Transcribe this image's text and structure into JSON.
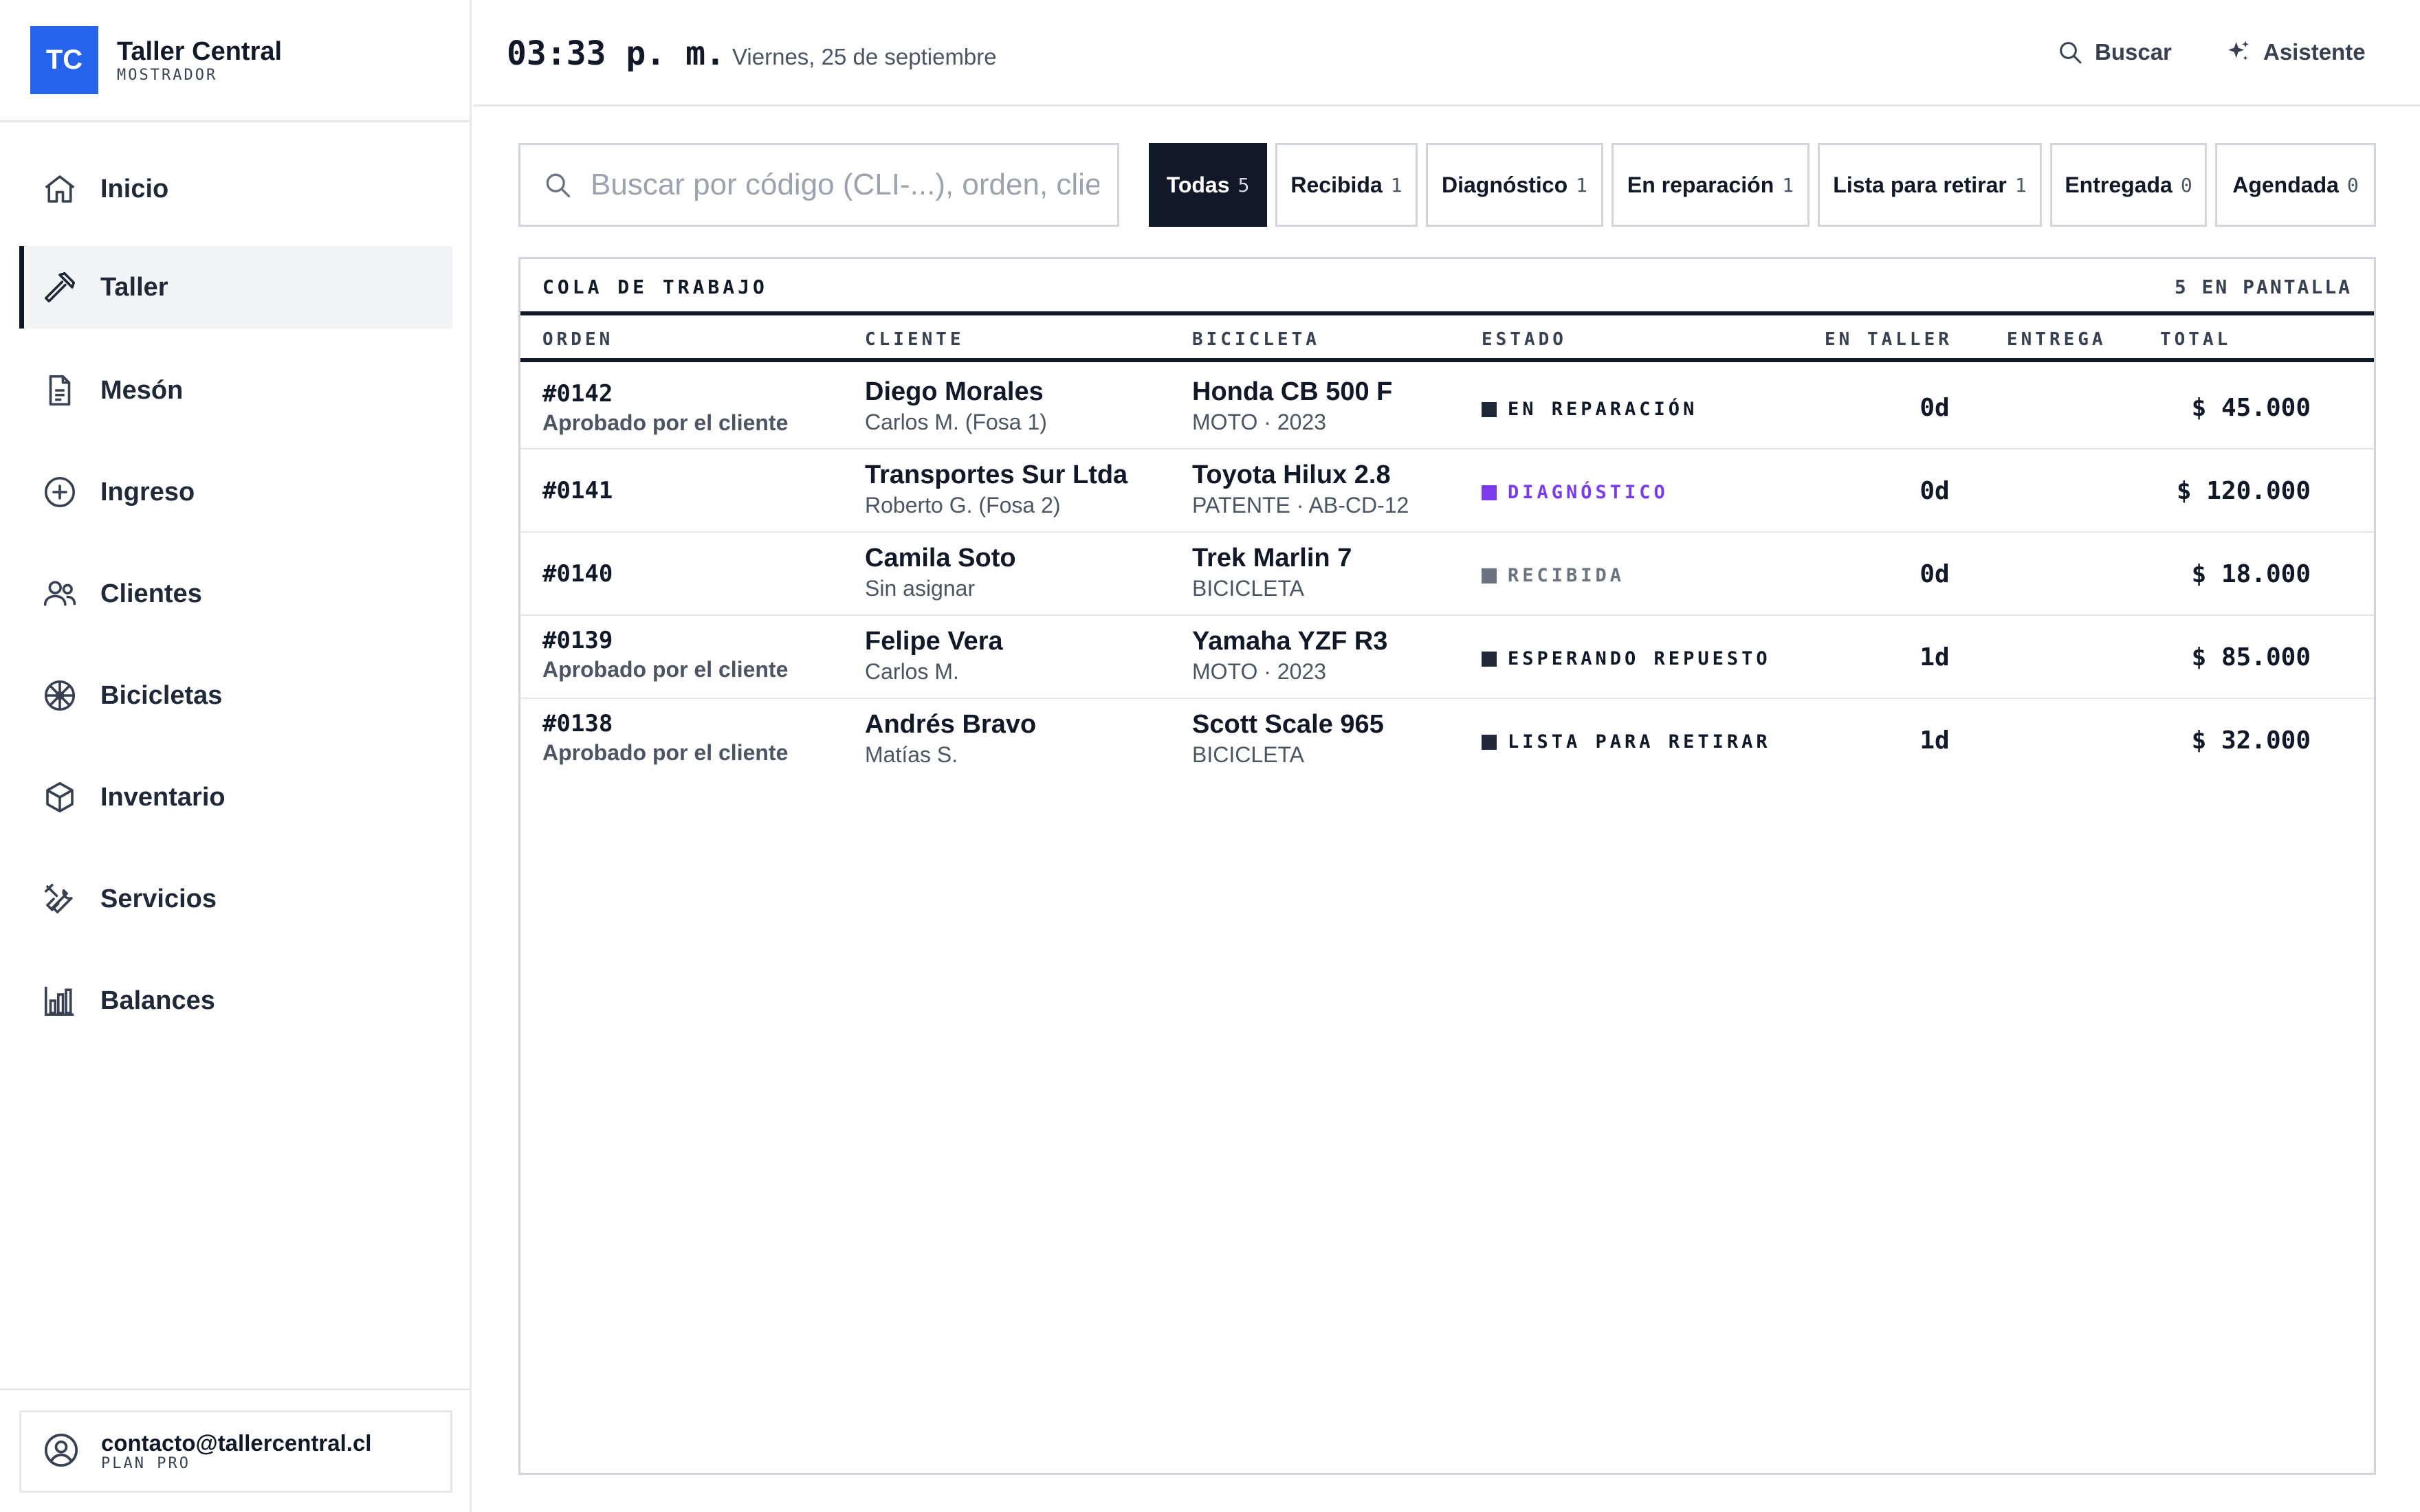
{
  "brand": {
    "logo": "TC",
    "name": "Taller Central",
    "role": "MOSTRADOR"
  },
  "nav": [
    {
      "label": "Inicio",
      "icon": "home-icon"
    },
    {
      "label": "Taller",
      "icon": "hammer-icon",
      "active": true
    },
    {
      "label": "Mesón",
      "icon": "document-icon"
    },
    {
      "label": "Ingreso",
      "icon": "plus-circle-icon"
    },
    {
      "label": "Clientes",
      "icon": "users-icon"
    },
    {
      "label": "Bicicletas",
      "icon": "wheel-icon"
    },
    {
      "label": "Inventario",
      "icon": "box-icon"
    },
    {
      "label": "Servicios",
      "icon": "tools-icon"
    },
    {
      "label": "Balances",
      "icon": "bar-chart-icon"
    }
  ],
  "account": {
    "email": "contacto@tallercentral.cl",
    "plan": "PLAN PRO"
  },
  "topbar": {
    "time": "03:33 p. m.",
    "date": "Viernes, 25 de septiembre",
    "search_label": "Buscar",
    "assistant_label": "Asistente"
  },
  "search": {
    "placeholder": "Buscar por código (CLI-...), orden, cliente",
    "value": ""
  },
  "filters": [
    {
      "label": "Todas",
      "count": "5",
      "active": true
    },
    {
      "label": "Recibida",
      "count": "1"
    },
    {
      "label": "Diagnóstico",
      "count": "1"
    },
    {
      "label": "En reparación",
      "count": "1"
    },
    {
      "label": "Lista para retirar",
      "count": "1"
    },
    {
      "label": "Entregada",
      "count": "0"
    },
    {
      "label": "Agendada",
      "count": "0"
    }
  ],
  "queue": {
    "title": "COLA DE TRABAJO",
    "count_label": "5 EN PANTALLA",
    "columns": {
      "order": "ORDEN",
      "client": "CLIENTE",
      "bike": "BICICLETA",
      "status": "ESTADO",
      "in_shop": "EN TALLER",
      "delivery": "ENTREGA",
      "total": "TOTAL"
    },
    "rows": [
      {
        "order": "#0142",
        "note": "Aprobado por el cliente",
        "client": "Diego Morales",
        "mechanic": "Carlos M. (Fosa 1)",
        "bike": "Honda CB 500 F",
        "bike_info": "MOTO · 2023",
        "status": "EN REPARACIÓN",
        "status_color": "#1f2937",
        "days": "0d",
        "delivery": "",
        "total": "$ 45.000"
      },
      {
        "order": "#0141",
        "note": "",
        "client": "Transportes Sur Ltda",
        "mechanic": "Roberto G. (Fosa 2)",
        "bike": "Toyota Hilux 2.8",
        "bike_info": "PATENTE · AB-CD-12",
        "status": "DIAGNÓSTICO",
        "status_color": "#7c3aed",
        "days": "0d",
        "delivery": "",
        "total": "$ 120.000"
      },
      {
        "order": "#0140",
        "note": "",
        "client": "Camila Soto",
        "mechanic": "Sin asignar",
        "bike": "Trek Marlin 7",
        "bike_info": "BICICLETA",
        "status": "RECIBIDA",
        "status_color": "#6b7280",
        "days": "0d",
        "delivery": "",
        "total": "$ 18.000"
      },
      {
        "order": "#0139",
        "note": "Aprobado por el cliente",
        "client": "Felipe Vera",
        "mechanic": "Carlos M.",
        "bike": "Yamaha YZF R3",
        "bike_info": "MOTO · 2023",
        "status": "ESPERANDO REPUESTO",
        "status_color": "#1f2937",
        "days": "1d",
        "delivery": "",
        "total": "$ 85.000"
      },
      {
        "order": "#0138",
        "note": "Aprobado por el cliente",
        "client": "Andrés Bravo",
        "mechanic": "Matías S.",
        "bike": "Scott Scale 965",
        "bike_info": "BICICLETA",
        "status": "LISTA PARA RETIRAR",
        "status_color": "#1f2937",
        "days": "1d",
        "delivery": "",
        "total": "$ 32.000"
      }
    ]
  }
}
